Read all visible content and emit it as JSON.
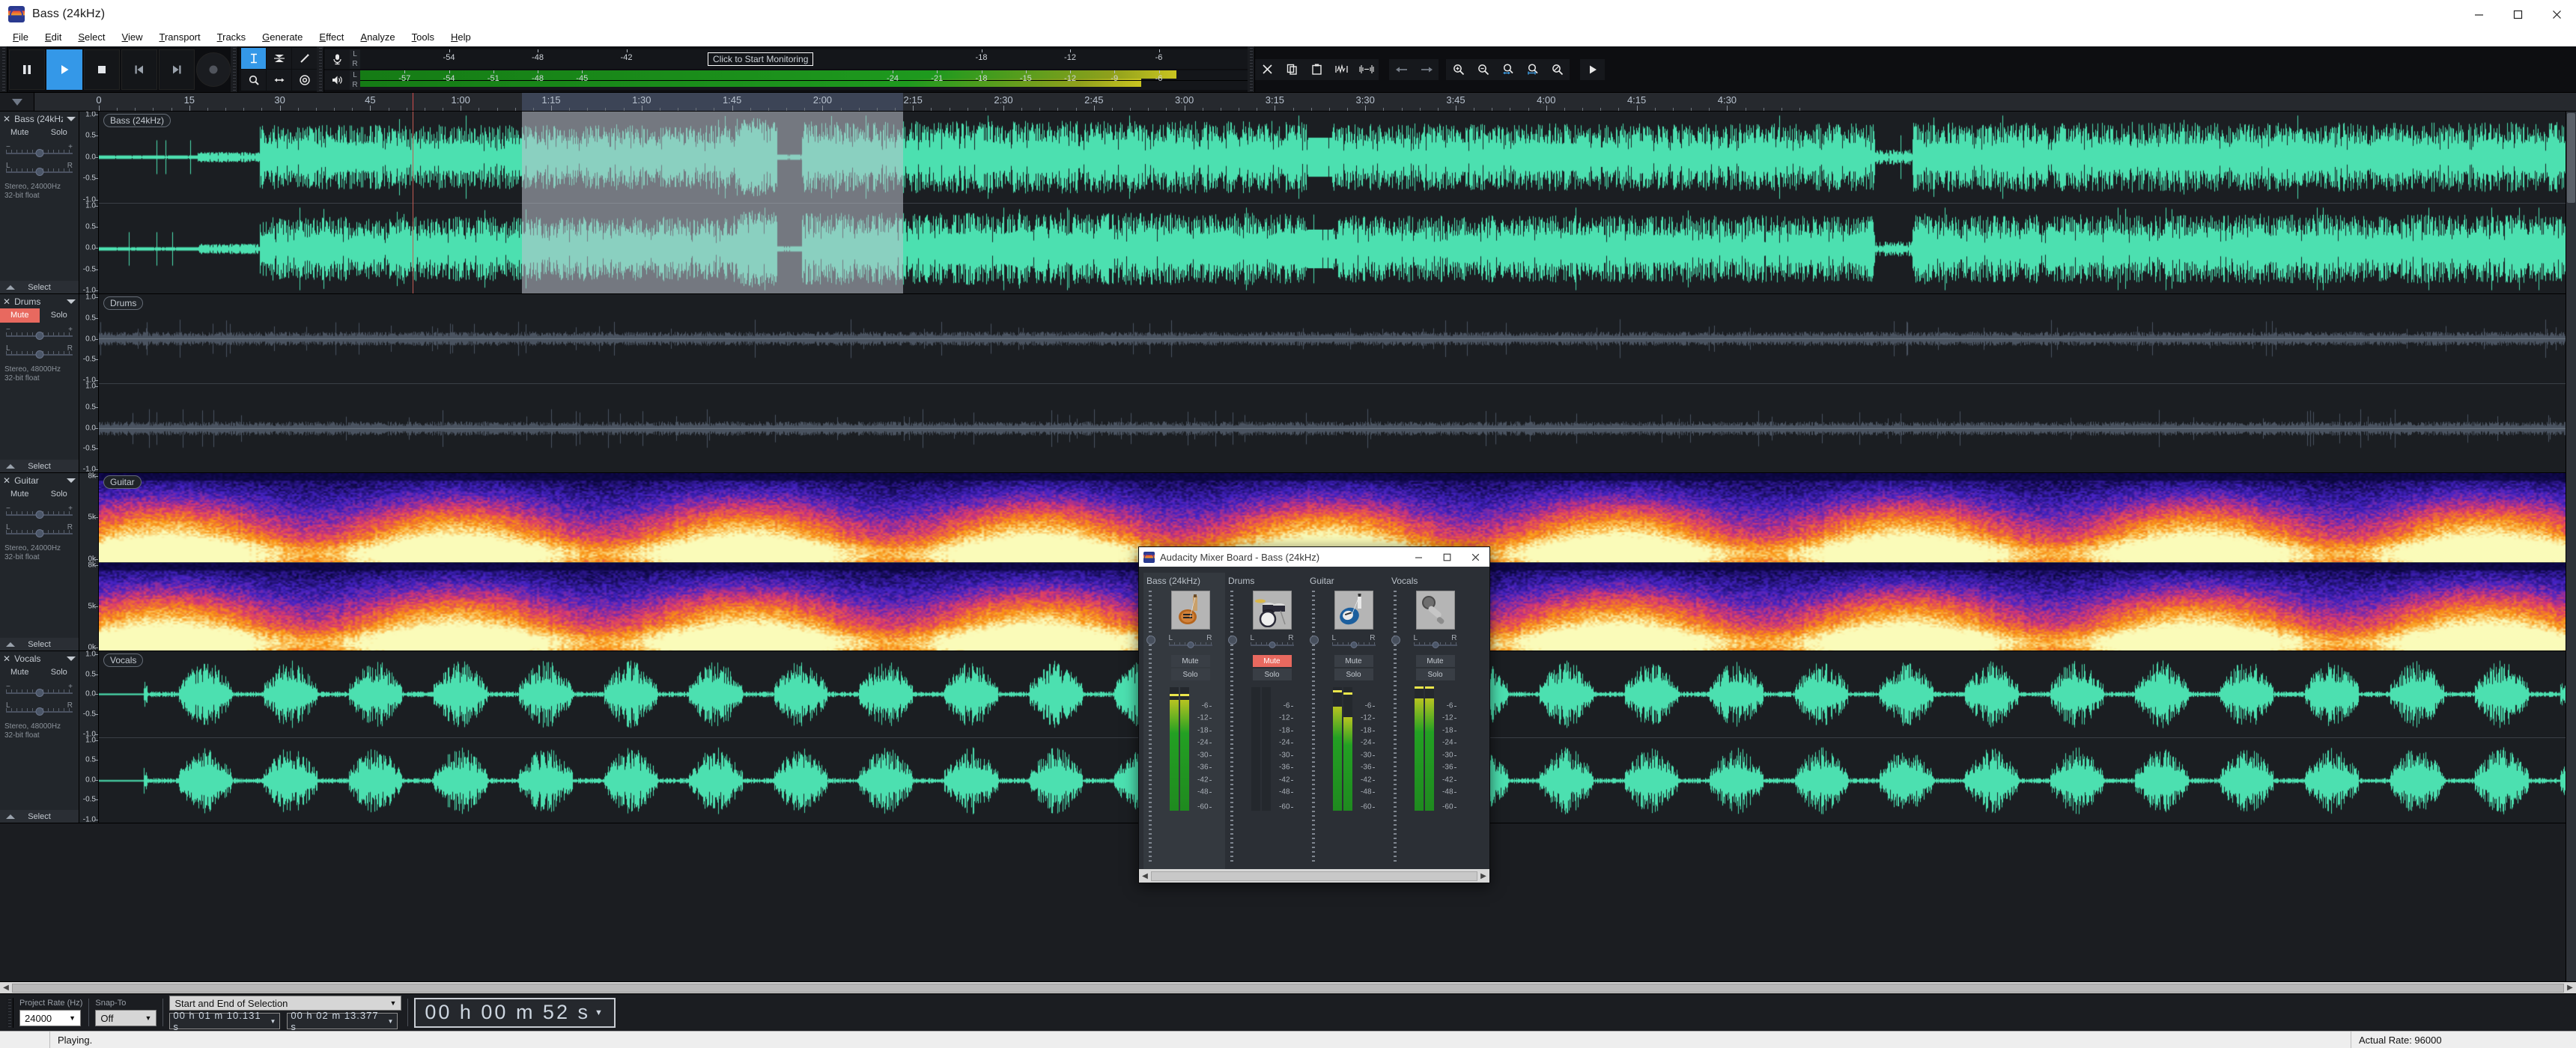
{
  "window": {
    "title": "Bass (24kHz)",
    "minimize": "—",
    "maximize": "☐",
    "close": "✕"
  },
  "menu": [
    "File",
    "Edit",
    "Select",
    "View",
    "Transport",
    "Tracks",
    "Generate",
    "Effect",
    "Analyze",
    "Tools",
    "Help"
  ],
  "transport": {
    "buttons": [
      {
        "name": "pause",
        "label": "Pause",
        "active": false
      },
      {
        "name": "play",
        "label": "Play",
        "active": true
      },
      {
        "name": "stop",
        "label": "Stop",
        "active": false
      },
      {
        "name": "skip-to-start",
        "label": "Skip to Start",
        "active": false
      },
      {
        "name": "skip-to-end",
        "label": "Skip to End",
        "active": false
      },
      {
        "name": "record",
        "label": "Record",
        "active": false
      }
    ]
  },
  "tools": {
    "row1": [
      "selection-tool",
      "envelope-tool",
      "draw-tool"
    ],
    "row2": [
      "zoom-tool",
      "time-shift-tool",
      "multi-tool"
    ],
    "selected": "selection-tool"
  },
  "meters": {
    "record": {
      "icon": "microphone-icon",
      "channels": [
        "L",
        "R"
      ],
      "hint": "Click to Start Monitoring",
      "ticks": [
        -54,
        -48,
        -42,
        -18,
        -12,
        -6
      ]
    },
    "play": {
      "icon": "speaker-icon",
      "channels": [
        "L",
        "R"
      ],
      "ticks": [
        -57,
        -54,
        -51,
        -48,
        -45,
        -24,
        -21,
        -18,
        -15,
        -12,
        -9,
        -6
      ],
      "level_l": 92,
      "level_r": 88
    }
  },
  "edit_tools": [
    "cut-icon",
    "copy-icon",
    "paste-icon",
    "trim-icon",
    "silence-icon"
  ],
  "nav_tools": [
    "undo-icon",
    "redo-icon"
  ],
  "zoom_tools": [
    "zoom-in-icon",
    "zoom-out-icon",
    "fit-selection-icon",
    "fit-project-icon",
    "zoom-toggle-icon"
  ],
  "play_at_speed": "play-at-speed-icon",
  "ruler": {
    "labels": [
      "0",
      "15",
      "30",
      "45",
      "1:00",
      "1:15",
      "1:30",
      "1:45",
      "2:00",
      "2:15",
      "2:30",
      "2:45",
      "3:00",
      "3:15",
      "3:30",
      "3:45",
      "4:00",
      "4:15",
      "4:30"
    ],
    "selection_start_label": "1:10.131",
    "selection_end_label": "2:13.377",
    "playhead_label": "0:52"
  },
  "tracks": [
    {
      "name": "Bass (24kHz)",
      "title_chip": "Bass (24kHz)",
      "mute": "Mute",
      "solo": "Solo",
      "mute_on": false,
      "solo_on": false,
      "info_line1": "Stereo, 24000Hz",
      "info_line2": "32-bit float",
      "select": "Select",
      "view": "waveform",
      "vscale": [
        "1.0",
        "0.5",
        "0.0",
        "-0.5",
        "-1.0"
      ],
      "waveform_color": "#4ce0b0",
      "selected": true
    },
    {
      "name": "Drums",
      "title_chip": "Drums",
      "mute": "Mute",
      "solo": "Solo",
      "mute_on": true,
      "solo_on": false,
      "info_line1": "Stereo, 48000Hz",
      "info_line2": "32-bit float",
      "select": "Select",
      "view": "waveform",
      "vscale": [
        "1.0",
        "0.5",
        "0.0",
        "-0.5",
        "-1.0"
      ],
      "waveform_color": "#4a5360",
      "selected": false
    },
    {
      "name": "Guitar",
      "title_chip": "Guitar",
      "mute": "Mute",
      "solo": "Solo",
      "mute_on": false,
      "solo_on": false,
      "info_line1": "Stereo, 24000Hz",
      "info_line2": "32-bit float",
      "select": "Select",
      "view": "spectrogram",
      "vscale": [
        "8k",
        "5k",
        "0k"
      ],
      "waveform_color": "#ff7a2a",
      "selected": false
    },
    {
      "name": "Vocals",
      "title_chip": "Vocals",
      "mute": "Mute",
      "solo": "Solo",
      "mute_on": false,
      "solo_on": false,
      "info_line1": "Stereo, 48000Hz",
      "info_line2": "32-bit float",
      "select": "Select",
      "view": "waveform",
      "vscale": [
        "1.0",
        "0.5",
        "0.0",
        "-0.5",
        "-1.0"
      ],
      "waveform_color": "#4ce0b0",
      "selected": false
    }
  ],
  "selection_bar": {
    "project_rate_label": "Project Rate (Hz)",
    "project_rate_value": "24000",
    "snap_to_label": "Snap-To",
    "snap_to_value": "Off",
    "selection_mode": "Start and End of Selection",
    "start_time": "00 h 01 m 10.131 s",
    "end_time": "00 h 02 m 13.377 s",
    "audio_position": "00 h 00 m 52 s"
  },
  "status": {
    "message": "Playing.",
    "actual_rate": "Actual Rate: 96000"
  },
  "mixer": {
    "title": "Audacity Mixer Board - Bass (24kHz)",
    "minimize": "—",
    "maximize": "☐",
    "close": "✕",
    "strips": [
      {
        "name": "Bass (24kHz)",
        "instrument": "bass-guitar-icon",
        "pan_l": "L",
        "pan_r": "R",
        "mute": "Mute",
        "solo": "Solo",
        "mute_on": false,
        "selected": true,
        "level_l": 90,
        "level_r": 90,
        "peak_l": 93,
        "peak_r": 93
      },
      {
        "name": "Drums",
        "instrument": "drum-kit-icon",
        "pan_l": "L",
        "pan_r": "R",
        "mute": "Mute",
        "solo": "Solo",
        "mute_on": true,
        "selected": false,
        "level_l": 0,
        "level_r": 0,
        "peak_l": 0,
        "peak_r": 0
      },
      {
        "name": "Guitar",
        "instrument": "electric-guitar-icon",
        "pan_l": "L",
        "pan_r": "R",
        "mute": "Mute",
        "solo": "Solo",
        "mute_on": false,
        "selected": false,
        "level_l": 84,
        "level_r": 76,
        "peak_l": 96,
        "peak_r": 94
      },
      {
        "name": "Vocals",
        "instrument": "microphone-icon",
        "pan_l": "L",
        "pan_r": "R",
        "mute": "Mute",
        "solo": "Solo",
        "mute_on": false,
        "selected": false,
        "level_l": 91,
        "level_r": 91,
        "peak_l": 99,
        "peak_r": 99
      }
    ],
    "meter_scale": [
      "-6",
      "-12",
      "-18",
      "-24",
      "-30",
      "-36",
      "-42",
      "-48",
      "-60"
    ]
  }
}
